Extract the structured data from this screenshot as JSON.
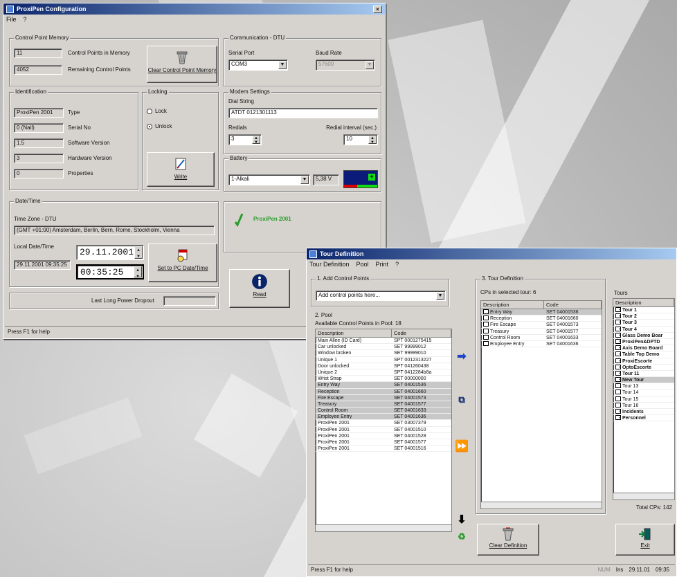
{
  "config_window": {
    "title": "ProxiPen Configuration",
    "close": "×",
    "menu": [
      "File",
      "?"
    ],
    "control_point_memory": {
      "group_label": "Control Point Memory",
      "points_in_memory_value": "11",
      "points_in_memory_label": "Control Points in Memory",
      "remaining_value": "4052",
      "remaining_label": "Remaining Control Points",
      "clear_button": "Clear Control Point Memory"
    },
    "communication": {
      "group_label": "Communication - DTU",
      "serial_port_label": "Serial Port",
      "serial_port_value": "COM3",
      "baud_rate_label": "Baud Rate",
      "baud_rate_value": "57600"
    },
    "identification": {
      "group_label": "Identification",
      "fields": [
        {
          "value": "ProxiPen 2001",
          "label": "Type"
        },
        {
          "value": "0 (Nail)",
          "label": "Serial No"
        },
        {
          "value": "1.5",
          "label": "Software Version"
        },
        {
          "value": "3",
          "label": "Hardware Version"
        },
        {
          "value": "0",
          "label": "Properties"
        }
      ]
    },
    "locking": {
      "group_label": "Locking",
      "lock": "Lock",
      "unlock": "Unlock",
      "write_button": "Write"
    },
    "modem": {
      "group_label": "Modem Settings",
      "dial_string_label": "Dial String",
      "dial_string_value": "ATDT 0121301113",
      "redials_label": "Redials",
      "redials_value": "3",
      "redial_interval_label": "Redial interval (sec.)",
      "redial_interval_value": "10"
    },
    "battery": {
      "group_label": "Battery",
      "type_value": "1-Alkali",
      "voltage": "5,38 V"
    },
    "datetime": {
      "group_label": "Date/Time",
      "time_zone_label": "Time Zone - DTU",
      "time_zone_value": "(GMT +01:00) Amsterdam, Berlin, Bern, Rome, Stockholm, Vienna",
      "local_label": "Local Date/Time",
      "local_value": "29.11.2001 09:35:25",
      "date_value": "29.11.2001",
      "time_value": "00:35:25",
      "set_pc_button": "Set to PC Date/Time"
    },
    "status_panel": {
      "device_name": "ProxiPen 2001"
    },
    "read_button": "Read",
    "last_power_label": "Last Long Power Dropout",
    "statusbar": "Press F1 for help"
  },
  "tour_window": {
    "title": "Tour Definition",
    "menu": [
      "Tour Definition",
      "Pool",
      "Print",
      "?"
    ],
    "step1_label": "1. Add Control Points",
    "step1_select": "Add control points here...",
    "step2_label": "2. Pool",
    "pool_caption": "Available Control Points in Pool: 18",
    "columns": [
      "Description",
      "Code"
    ],
    "pool": [
      [
        "Main Allee (ID Card)",
        "SPT 0001275415"
      ],
      [
        "Car unlocked",
        "SET 99999012"
      ],
      [
        "Window broken",
        "SET 99999010"
      ],
      [
        "Unique 1",
        "SPT 0012313227"
      ],
      [
        "Door unlocked",
        "SPT 041260438"
      ],
      [
        "Unique 2",
        "SPT 0412284b8a"
      ],
      [
        "Wrist Strap",
        "SET 00000000"
      ],
      [
        "Entry Way",
        "SET 04001536"
      ],
      [
        "Reception",
        "SET 04001660"
      ],
      [
        "Fire Escape",
        "SET 04001573"
      ],
      [
        "Treasury",
        "SET 04001577"
      ],
      [
        "Control Room",
        "SET 04001633"
      ],
      [
        "Employee Entry",
        "SET 04001636"
      ],
      [
        "ProxiPen 2001",
        "SET 03007379"
      ],
      [
        "ProxiPen 2001",
        "SET 04001510"
      ],
      [
        "ProxiPen 2001",
        "SET 04001528"
      ],
      [
        "ProxiPen 2001",
        "SET 04001577"
      ],
      [
        "ProxiPen 2001",
        "SET 04001516"
      ]
    ],
    "step3_label": "3. Tour Definition",
    "tour_caption": "CPs in selected tour: 6",
    "tour_points": [
      [
        "Entry Way",
        "SET 04001536"
      ],
      [
        "Reception",
        "SET 04001660"
      ],
      [
        "Fire Escape",
        "SET 04001573"
      ],
      [
        "Treasury",
        "SET 04001577"
      ],
      [
        "Control Room",
        "SET 04001633"
      ],
      [
        "Employee Entry",
        "SET 04001636"
      ]
    ],
    "tours_label": "Tours",
    "tours_header": "Description",
    "tours": [
      {
        "name": "Tour 1",
        "checked": true,
        "bold": true
      },
      {
        "name": "Tour 2",
        "checked": true,
        "bold": true
      },
      {
        "name": "Tour 3",
        "checked": true,
        "bold": true
      },
      {
        "name": "Tour 4",
        "checked": true,
        "bold": true
      },
      {
        "name": "Glass Demo Boar",
        "checked": true,
        "bold": true
      },
      {
        "name": "ProxiPen&DPTD",
        "checked": true,
        "bold": true
      },
      {
        "name": "Axis Demo Board",
        "checked": true,
        "bold": true
      },
      {
        "name": "Table Top Demo",
        "checked": true,
        "bold": true
      },
      {
        "name": "ProxiEscorte",
        "checked": true,
        "bold": true
      },
      {
        "name": "OptoEscorte",
        "checked": true,
        "bold": true
      },
      {
        "name": "Tour 11",
        "checked": true,
        "bold": true
      },
      {
        "name": "New Tour",
        "checked": true,
        "bold": true
      },
      {
        "name": "Tour 13",
        "checked": false,
        "bold": false
      },
      {
        "name": "Tour 14",
        "checked": false,
        "bold": false
      },
      {
        "name": "Tour 15",
        "checked": false,
        "bold": false
      },
      {
        "name": "Tour 16",
        "checked": false,
        "bold": false
      },
      {
        "name": "Incidents",
        "checked": true,
        "bold": true
      },
      {
        "name": "Personnel",
        "checked": true,
        "bold": true
      }
    ],
    "total_cps": "Total CPs: 142",
    "clear_definition_button": "Clear Definition",
    "exit_button": "Exit",
    "statusbar": "Press F1 for help",
    "status_right": [
      "NUM",
      "Ins",
      "29.11.01",
      "09:35"
    ]
  }
}
